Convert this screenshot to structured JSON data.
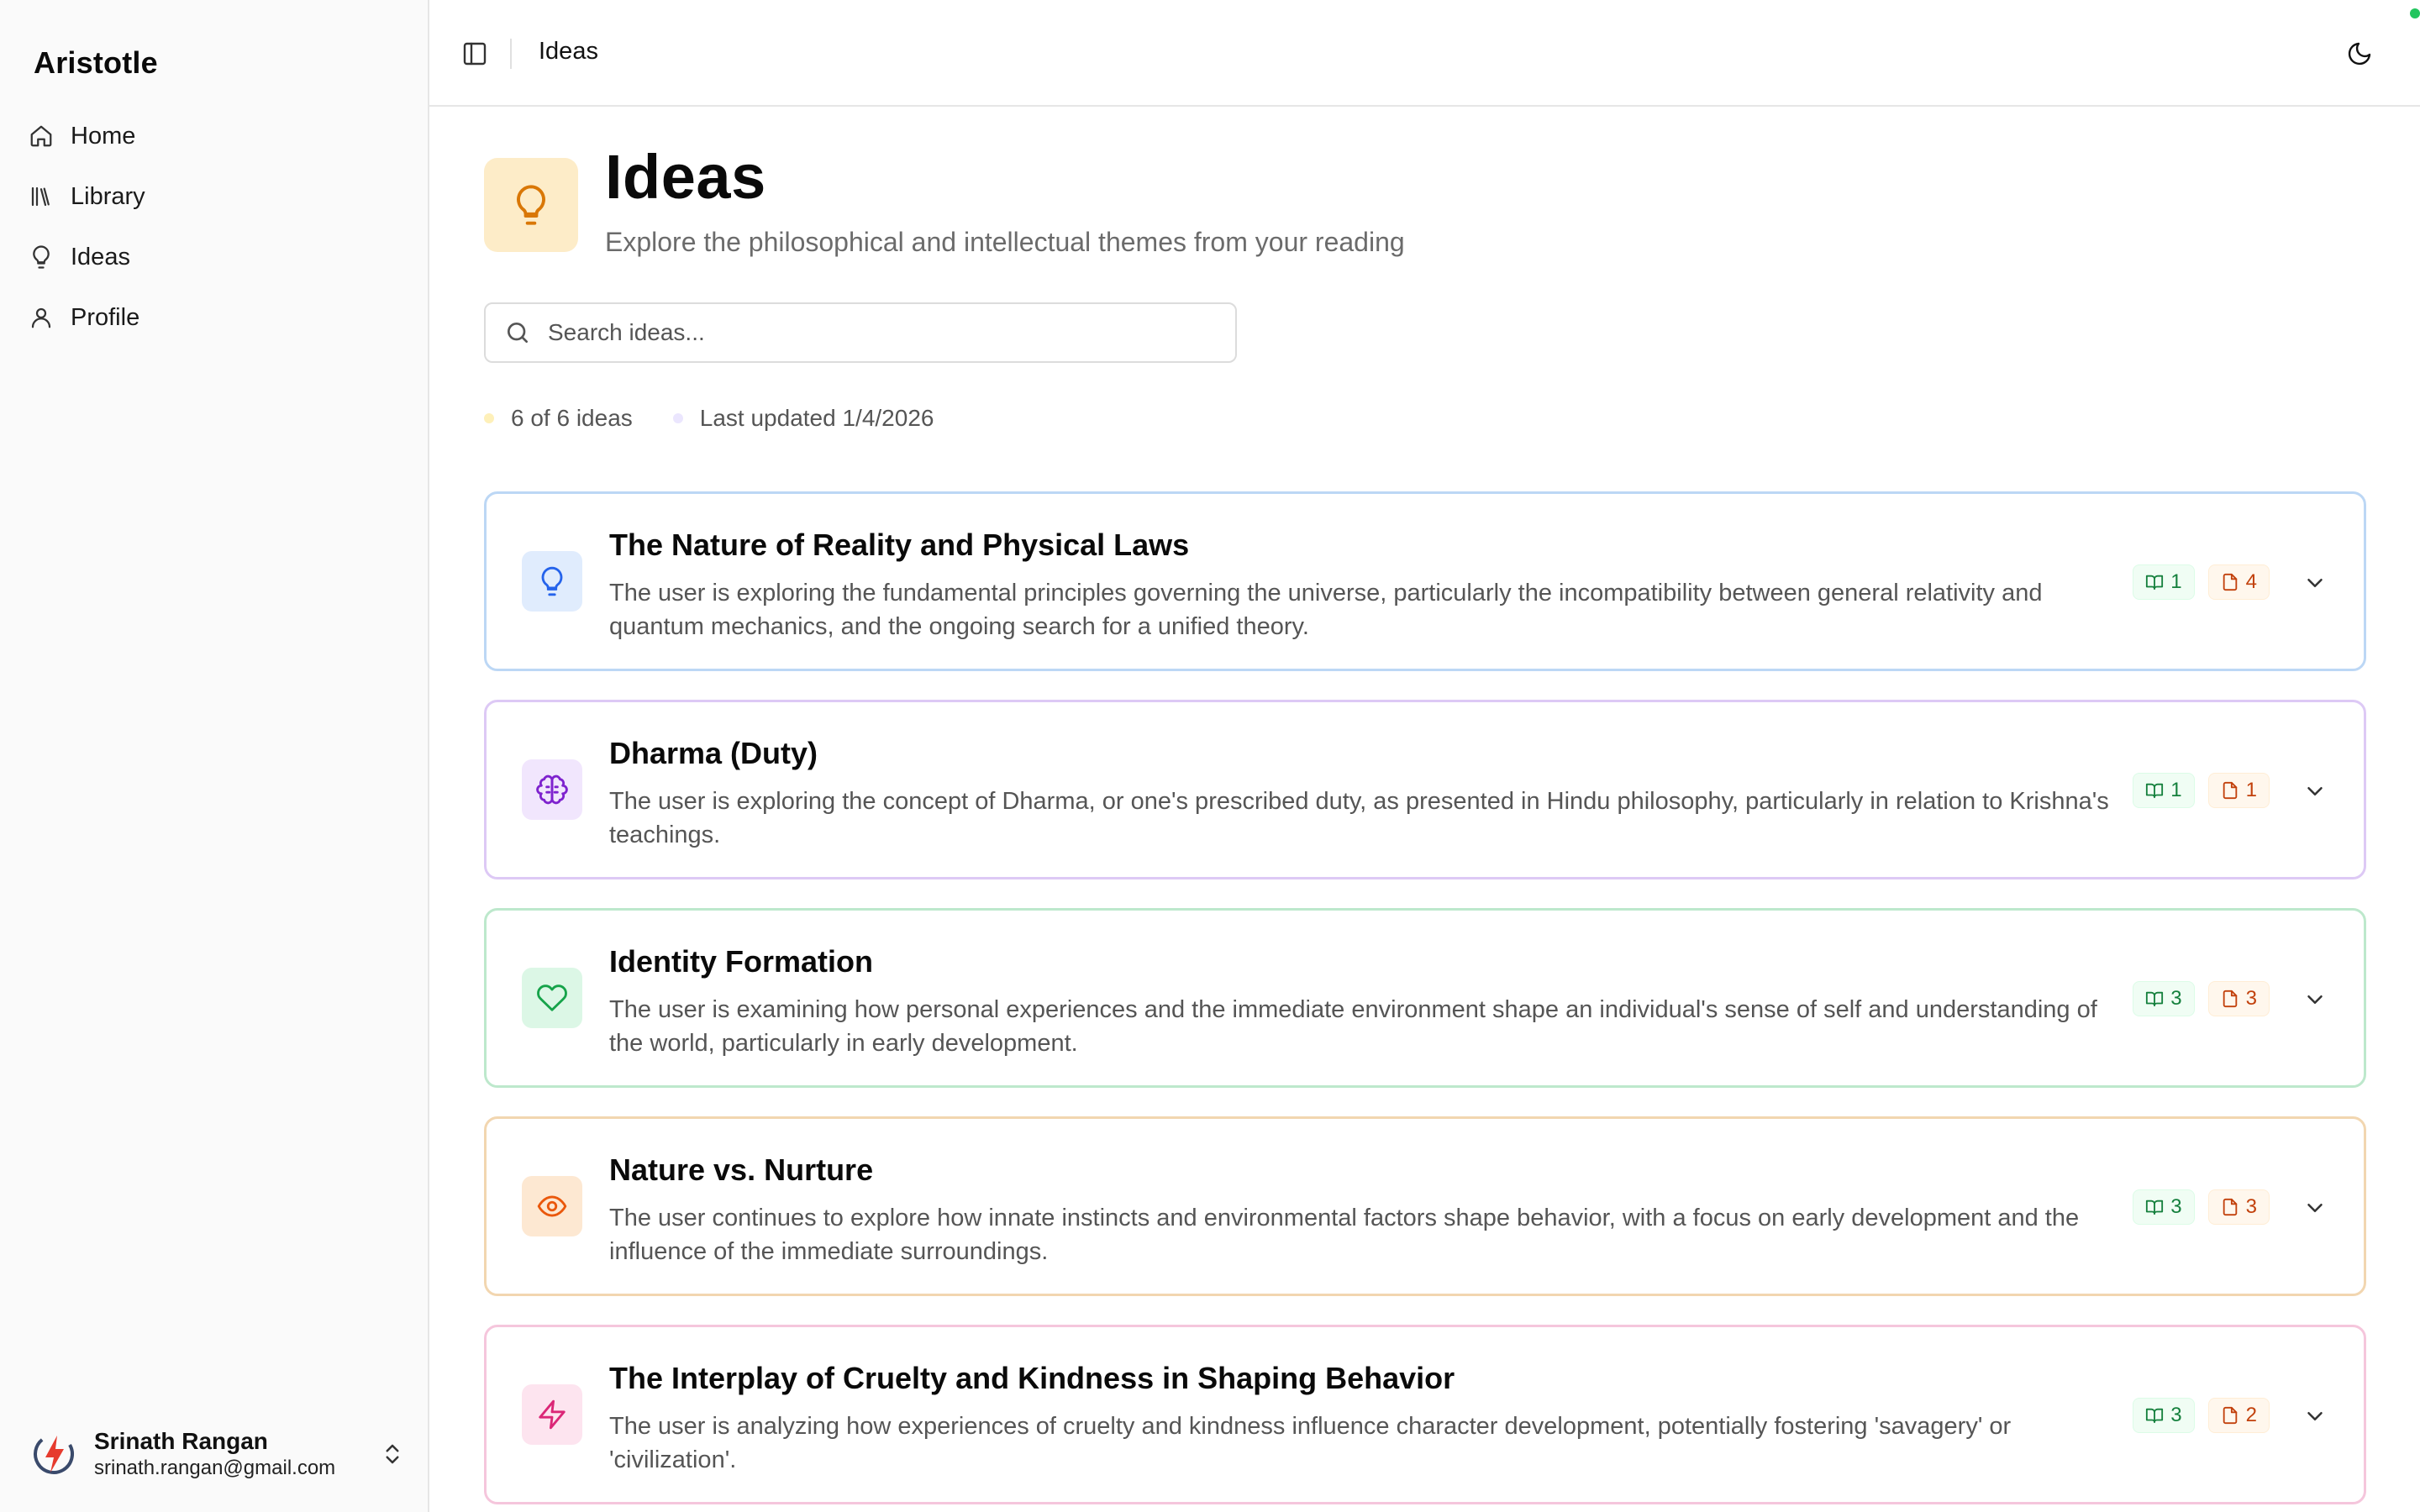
{
  "sidebar": {
    "brand": "Aristotle",
    "nav": [
      {
        "label": "Home",
        "icon": "home-icon"
      },
      {
        "label": "Library",
        "icon": "library-icon"
      },
      {
        "label": "Ideas",
        "icon": "lightbulb-icon"
      },
      {
        "label": "Profile",
        "icon": "user-icon"
      }
    ],
    "user": {
      "name": "Srinath Rangan",
      "email": "srinath.rangan@gmail.com"
    }
  },
  "topbar": {
    "title": "Ideas"
  },
  "header": {
    "title": "Ideas",
    "subtitle": "Explore the philosophical and intellectual themes from your reading",
    "accent": "#d97706"
  },
  "search": {
    "placeholder": "Search ideas..."
  },
  "meta": {
    "count": "6 of 6 ideas",
    "updated": "Last updated 1/4/2026"
  },
  "ideas": [
    {
      "title": "The Nature of Reality and Physical Laws",
      "description": "The user is exploring the fundamental principles governing the universe, particularly the incompatibility between general relativity and quantum mechanics, and the ongoing search for a unified theory.",
      "books": "1",
      "notes": "4",
      "icon": "lightbulb-icon",
      "border": "#bcd7f5",
      "icon_bg": "#e0ecfd",
      "icon_color": "#2563eb"
    },
    {
      "title": "Dharma (Duty)",
      "description": "The user is exploring the concept of Dharma, or one's prescribed duty, as presented in Hindu philosophy, particularly in relation to Krishna's teachings.",
      "books": "1",
      "notes": "1",
      "icon": "brain-icon",
      "border": "#ddc9f5",
      "icon_bg": "#f1e6fd",
      "icon_color": "#7e22ce"
    },
    {
      "title": "Identity Formation",
      "description": "The user is examining how personal experiences and the immediate environment shape an individual's sense of self and understanding of the world, particularly in early development.",
      "books": "3",
      "notes": "3",
      "icon": "heart-icon",
      "border": "#bde8cc",
      "icon_bg": "#dcf7e6",
      "icon_color": "#16a34a"
    },
    {
      "title": "Nature vs. Nurture",
      "description": "The user continues to explore how innate instincts and environmental factors shape behavior, with a focus on early development and the influence of the immediate surroundings.",
      "books": "3",
      "notes": "3",
      "icon": "eye-icon",
      "border": "#f2d6b0",
      "icon_bg": "#fde8d2",
      "icon_color": "#ea580c"
    },
    {
      "title": "The Interplay of Cruelty and Kindness in Shaping Behavior",
      "description": "The user is analyzing how experiences of cruelty and kindness influence character development, potentially fostering 'savagery' or 'civilization'.",
      "books": "3",
      "notes": "2",
      "icon": "zap-icon",
      "border": "#f5c6dc",
      "icon_bg": "#fde4ef",
      "icon_color": "#db2777"
    }
  ]
}
